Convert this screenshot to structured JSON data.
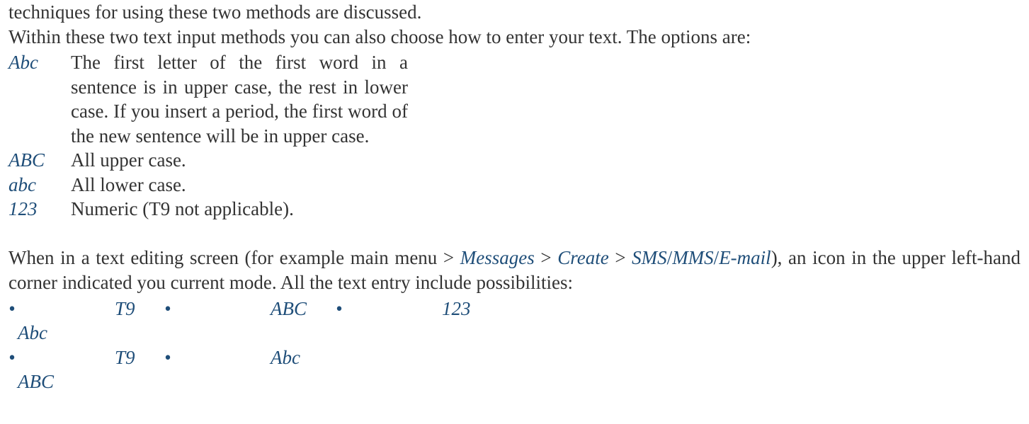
{
  "intro": {
    "line1": "techniques for using these two methods are discussed.",
    "line2": "Within these two text input methods you can also choose how to enter your text. The options are:"
  },
  "defs": [
    {
      "term": "Abc",
      "desc": "The first letter of the first word in a sentence is in upper case, the rest in lower case. If you insert a period, the first word of the new sentence will be in upper case."
    },
    {
      "term": "ABC",
      "desc": "All upper case."
    },
    {
      "term": "abc",
      "desc": "All lower case."
    },
    {
      "term": "123",
      "desc": "Numeric (T9 not applicable)."
    }
  ],
  "path_para": {
    "prefix": "When in a text editing screen (for example main menu > ",
    "seg1": "Messages",
    "sep1": " > ",
    "seg2": "Create",
    "sep2": " > ",
    "seg3": "SMS",
    "slash1": "/",
    "seg4": "MMS",
    "slash2": "/",
    "seg5": "E-mail",
    "suffix": "), an icon in the upper left-hand corner indicated you current mode. All the text entry include possibilities:"
  },
  "modes": {
    "rows": [
      {
        "c1_a": "•",
        "c1_b": "  Abc",
        "c2": "T9",
        "c3": "•",
        "c4": "ABC",
        "c5": "•",
        "c6": "123"
      },
      {
        "c1_a": "•",
        "c1_b": "  ABC",
        "c2": "T9",
        "c3": "•",
        "c4": "Abc",
        "c5": "",
        "c6": ""
      }
    ]
  }
}
